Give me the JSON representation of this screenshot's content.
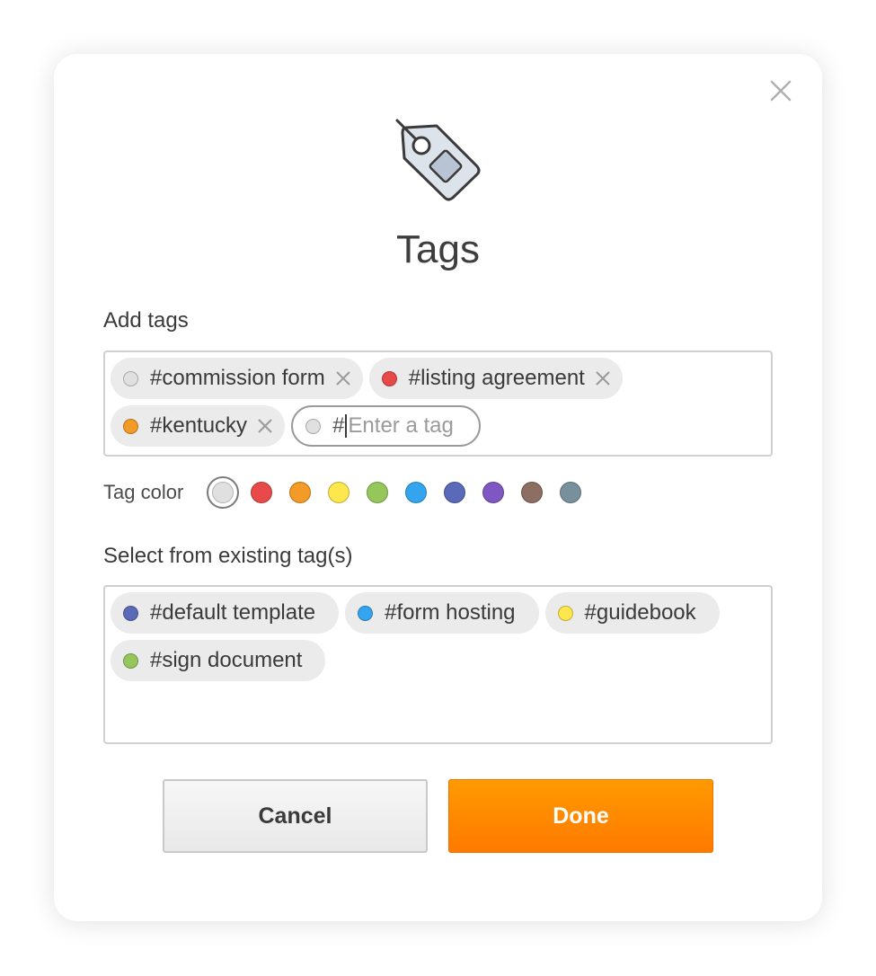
{
  "dialog": {
    "title": "Tags",
    "add_tags_label": "Add tags",
    "tag_color_label": "Tag color",
    "existing_label": "Select from existing tag(s)",
    "cancel_label": "Cancel",
    "done_label": "Done"
  },
  "added_tags": [
    {
      "label": "#commission form",
      "color": "#e0e0e0"
    },
    {
      "label": "#listing agreement",
      "color": "#e84a4a"
    },
    {
      "label": "#kentucky",
      "color": "#f39a27"
    }
  ],
  "input": {
    "prefix": "#",
    "placeholder": "Enter a tag",
    "value": "",
    "dot_color": "#e0e0e0"
  },
  "tag_colors": [
    "#e0e0e0",
    "#e84a4a",
    "#f39a27",
    "#fde74c",
    "#95c65c",
    "#35a4ef",
    "#5a69b8",
    "#7e57c2",
    "#8d6e63",
    "#78909c"
  ],
  "selected_color": "#e0e0e0",
  "existing_tags": [
    {
      "label": "#default template",
      "color": "#5a69b8"
    },
    {
      "label": "#form hosting",
      "color": "#35a4ef"
    },
    {
      "label": "#guidebook",
      "color": "#fde74c"
    },
    {
      "label": "#sign document",
      "color": "#95c65c"
    }
  ]
}
